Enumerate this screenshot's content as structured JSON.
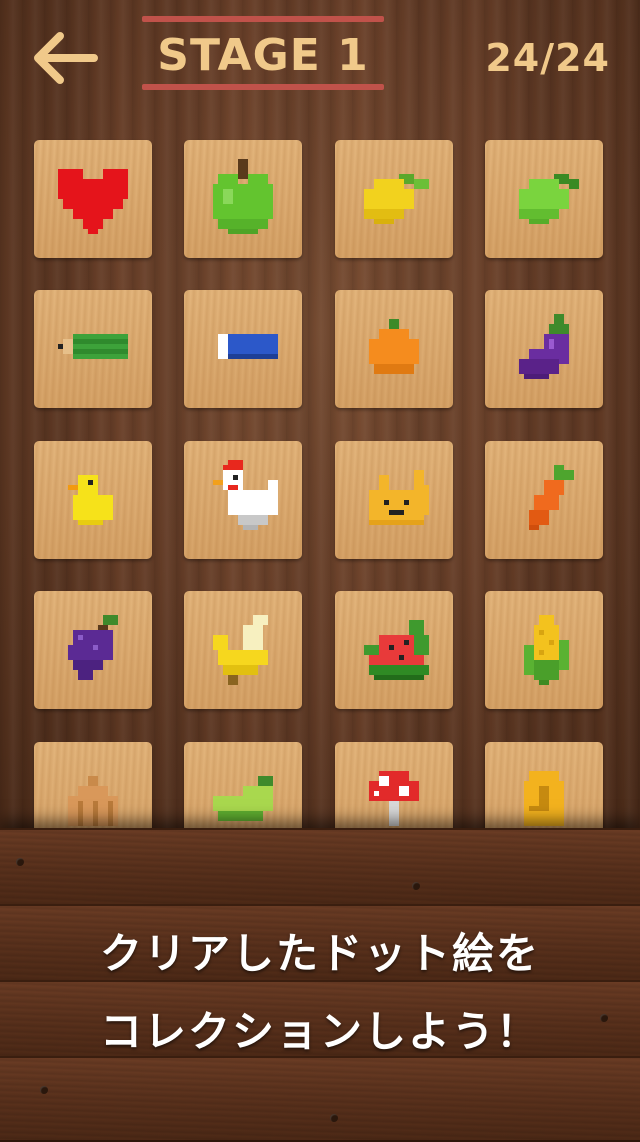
{
  "header": {
    "back_icon": "arrow-left-icon",
    "stage_title": "STAGE 1",
    "progress": "24/24"
  },
  "collection": {
    "items": [
      {
        "name": "heart-pixel-icon"
      },
      {
        "name": "apple-pixel-icon"
      },
      {
        "name": "lemon-pixel-icon"
      },
      {
        "name": "lime-pixel-icon"
      },
      {
        "name": "pencil-pixel-icon"
      },
      {
        "name": "eraser-pixel-icon"
      },
      {
        "name": "orange-pixel-icon"
      },
      {
        "name": "eggplant-pixel-icon"
      },
      {
        "name": "chick-pixel-icon"
      },
      {
        "name": "chicken-pixel-icon"
      },
      {
        "name": "fox-pixel-icon"
      },
      {
        "name": "carrot-pixel-icon"
      },
      {
        "name": "grapes-pixel-icon"
      },
      {
        "name": "banana-pixel-icon"
      },
      {
        "name": "watermelon-pixel-icon"
      },
      {
        "name": "corn-pixel-icon"
      },
      {
        "name": "onion-pixel-icon"
      },
      {
        "name": "cucumber-pixel-icon"
      },
      {
        "name": "mushroom-pixel-icon"
      },
      {
        "name": "coin-pixel-icon"
      }
    ]
  },
  "promo": {
    "line1": "クリアしたドット絵を",
    "line2": "コレクションしよう！"
  },
  "colors": {
    "title_text": "#f0c98a",
    "title_lines": "#c0524a",
    "tile": "#dfae74"
  }
}
